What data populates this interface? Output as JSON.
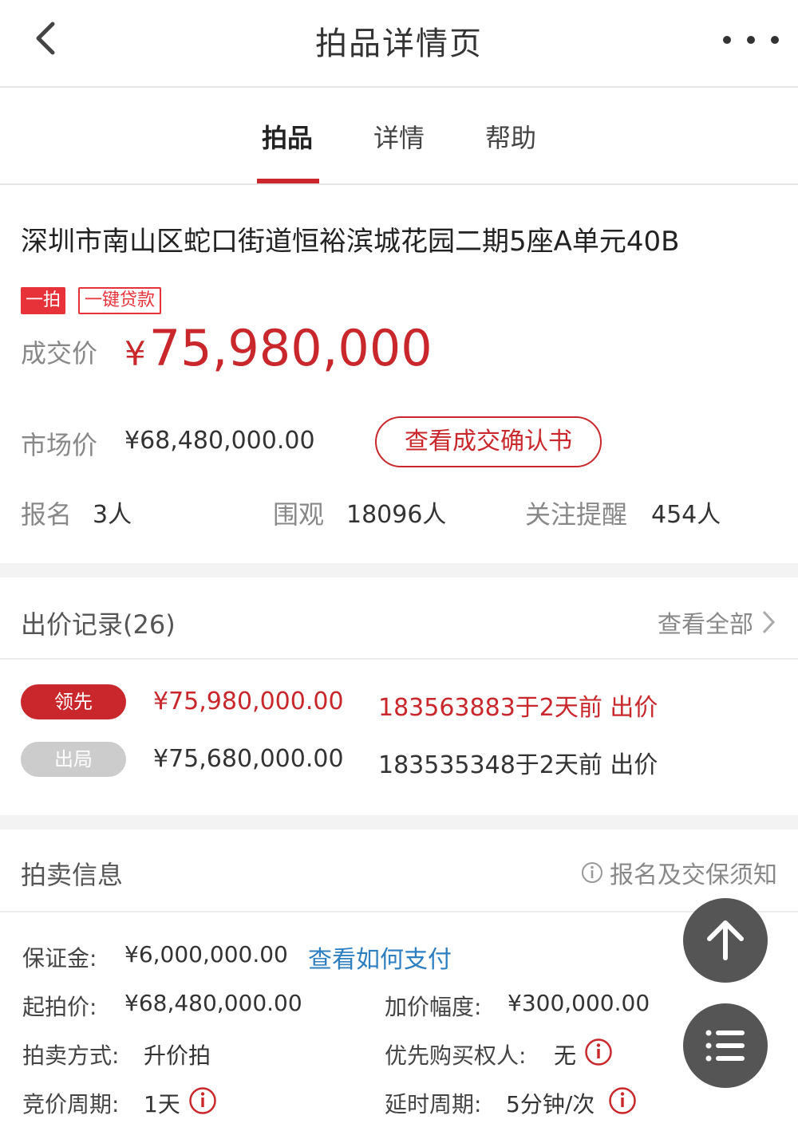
{
  "header": {
    "title": "拍品详情页",
    "back_icon": "chevron-left-icon",
    "more_icon": "more-horizontal-icon"
  },
  "tabs": [
    {
      "label": "拍品",
      "active": true
    },
    {
      "label": "详情",
      "active": false
    },
    {
      "label": "帮助",
      "active": false
    }
  ],
  "product": {
    "title": "深圳市南山区蛇口街道恒裕滨城花园二期5座A单元40B",
    "badges": [
      "一拍",
      "一键贷款"
    ],
    "deal_label": "成交价",
    "deal_currency": "¥",
    "deal_price": "75,980,000",
    "market_label": "市场价",
    "market_value": "¥68,480,000.00",
    "confirm_button": "查看成交确认书",
    "stats": [
      {
        "label": "报名",
        "value": "3人"
      },
      {
        "label": "围观",
        "value": "18096人"
      },
      {
        "label": "关注提醒",
        "value": "454人"
      }
    ]
  },
  "bids": {
    "heading": "出价记录(26)",
    "view_all": "查看全部",
    "records": [
      {
        "status": "领先",
        "amount": "¥75,980,000.00",
        "bidder": "183563883于2天前 出价"
      },
      {
        "status": "出局",
        "amount": "¥75,680,000.00",
        "bidder": "183535348于2天前 出价"
      }
    ]
  },
  "auction_info": {
    "heading": "拍卖信息",
    "notice": "报名及交保须知",
    "deposit_label": "保证金:",
    "deposit_value": "¥6,000,000.00",
    "pay_link": "查看如何支付",
    "start_label": "起拍价:",
    "start_value": "¥68,480,000.00",
    "increment_label": "加价幅度:",
    "increment_value": "¥300,000.00",
    "method_label": "拍卖方式:",
    "method_value": "升价拍",
    "priority_label": "优先购买权人:",
    "priority_value": "无",
    "cycle_label": "竞价周期:",
    "cycle_value": "1天",
    "delay_label": "延时周期:",
    "delay_value": "5分钟/次"
  },
  "fabs": {
    "top_icon": "arrow-up-icon",
    "menu_icon": "list-icon"
  },
  "colors": {
    "accent": "#c9272b",
    "link": "#2d7fc1",
    "fab": "#555555"
  }
}
